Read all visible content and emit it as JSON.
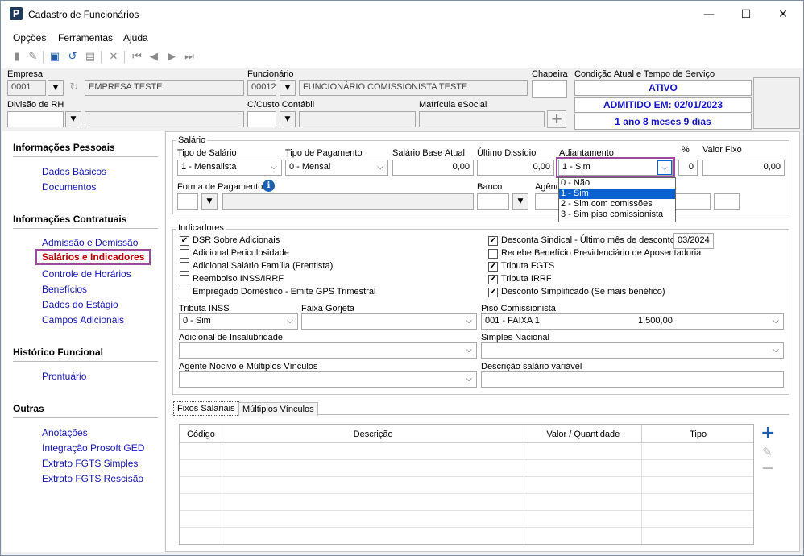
{
  "window": {
    "title": "Cadastro de Funcionários",
    "minimize": "—",
    "maximize": "☐",
    "close": "✕"
  },
  "menu": {
    "opcoes": "Opções",
    "ferramentas": "Ferramentas",
    "ajuda": "Ajuda"
  },
  "header": {
    "empresa_label": "Empresa",
    "empresa_code": "0001",
    "empresa_name": "EMPRESA TESTE",
    "funcionario_label": "Funcionário",
    "funcionario_code": "00012",
    "funcionario_name": "FUNCIONÁRIO COMISSIONISTA TESTE",
    "chapeira_label": "Chapeira",
    "chapeira_value": "",
    "condicao_label": "Condição Atual e Tempo de Serviço",
    "status_ativo": "ATIVO",
    "status_admitido": "ADMITIDO EM: 02/01/2023",
    "status_tempo": "1 ano 8 meses 9 dias",
    "divisao_label": "Divisão de RH",
    "ccusto_label": "C/Custo Contábil",
    "matricula_label": "Matrícula eSocial",
    "add_symbol": "+"
  },
  "sidebar": {
    "sections": [
      {
        "title": "Informações Pessoais",
        "items": [
          "Dados Básicos",
          "Documentos"
        ]
      },
      {
        "title": "Informações Contratuais",
        "items": [
          "Admissão e Demissão",
          "Salários e Indicadores",
          "Controle de Horários",
          "Benefícios",
          "Dados do Estágio",
          "Campos Adicionais"
        ]
      },
      {
        "title": "Histórico Funcional",
        "items": [
          "Prontuário"
        ]
      },
      {
        "title": "Outras",
        "items": [
          "Anotações",
          "Integração Prosoft GED",
          "Extrato FGTS Simples",
          "Extrato FGTS Rescisão"
        ]
      }
    ],
    "active_item": "Salários e Indicadores"
  },
  "salario": {
    "group_title": "Salário",
    "tipo_salario_label": "Tipo de Salário",
    "tipo_salario_value": "1 - Mensalista",
    "tipo_pagamento_label": "Tipo de Pagamento",
    "tipo_pagamento_value": "0 - Mensal",
    "salario_base_label": "Salário Base Atual",
    "salario_base_value": "0,00",
    "ultimo_dissidio_label": "Último Dissídio",
    "ultimo_dissidio_value": "0,00",
    "adiantamento_label": "Adiantamento",
    "adiantamento_value": "1 - Sim",
    "percent_label": "%",
    "percent_value": "0",
    "valor_fixo_label": "Valor Fixo",
    "valor_fixo_value": "0,00",
    "forma_pagamento_label": "Forma de Pagamento",
    "banco_label": "Banco",
    "agencia_label": "Agênc",
    "adiantamento_options": [
      "0 - Não",
      "1 - Sim",
      "2 - Sim com comissões",
      "3 - Sim piso comissionista"
    ],
    "adiantamento_selected_index": 1
  },
  "indicadores": {
    "group_title": "Indicadores",
    "left": [
      {
        "label": "DSR Sobre Adicionais",
        "checked": true
      },
      {
        "label": "Adicional Periculosidade",
        "checked": false
      },
      {
        "label": "Adicional Salário Família (Frentista)",
        "checked": false
      },
      {
        "label": "Reembolso INSS/IRRF",
        "checked": false
      },
      {
        "label": "Empregado Doméstico - Emite GPS Trimestral",
        "checked": false
      }
    ],
    "right": [
      {
        "label": "Desconta Sindical - Último mês de desconto",
        "checked": true
      },
      {
        "label": "Recebe Benefício Previdenciário de Aposentadoria",
        "checked": false
      },
      {
        "label": "Tributa FGTS",
        "checked": true
      },
      {
        "label": "Tributa IRRF",
        "checked": true
      },
      {
        "label": "Desconto Simplificado (Se mais benéfico)",
        "checked": true
      }
    ],
    "ultimo_mes_value": "03/2024",
    "tributa_inss_label": "Tributa INSS",
    "tributa_inss_value": "0 - Sim",
    "faixa_gorjeta_label": "Faixa Gorjeta",
    "faixa_gorjeta_value": "",
    "piso_label": "Piso Comissionista",
    "piso_value": "001 - FAIXA 1",
    "piso_amount": "1.500,00",
    "insalubridade_label": "Adicional de Insalubridade",
    "simples_label": "Simples Nacional",
    "agente_label": "Agente Nocivo e  Múltiplos Vínculos",
    "descricao_var_label": "Descrição salário variável"
  },
  "tabs": [
    "Fixos Salariais",
    "Múltiplos Vínculos"
  ],
  "grid": {
    "columns": [
      "Código",
      "Descrição",
      "Valor / Quantidade",
      "Tipo"
    ]
  },
  "grid_tools": {
    "add": "+",
    "edit": "✎",
    "remove": "—"
  },
  "icons": {
    "info": "i",
    "dropdown": "▼",
    "combo": "⌵",
    "check": "✔"
  }
}
